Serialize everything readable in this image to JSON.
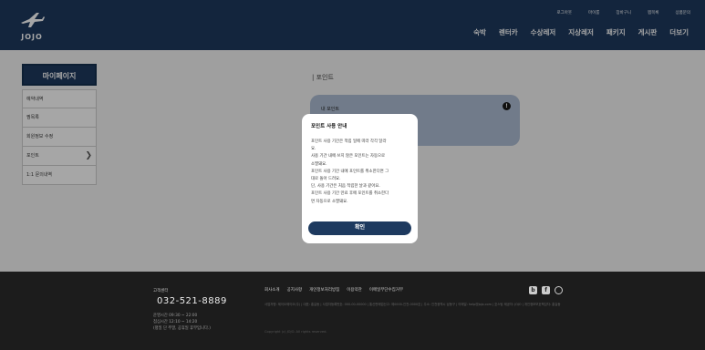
{
  "header": {
    "logo_text": "JOJO",
    "util_nav": [
      "로그아웃",
      "마이룸",
      "장바구니",
      "찜목록",
      "상품문의"
    ],
    "main_nav": [
      "숙박",
      "렌터카",
      "수상레저",
      "지상레저",
      "패키지",
      "게시판",
      "더보기"
    ]
  },
  "sidebar": {
    "title": "마이페이지",
    "items": [
      "예약내역",
      "찜목록",
      "회원정보 수정",
      "포인트",
      "1:1 문의내역"
    ]
  },
  "content": {
    "heading": "| 포인트",
    "card_label": "내 포인트"
  },
  "modal": {
    "title": "포인트 사용 안내",
    "lines": [
      "포인트 사용 기간은 적립 일에 따라 각각 달라",
      "요.",
      "사용 기간 내에 쓰지 않은 포인트는 자동으로",
      "소멸돼요.",
      "포인트 사용 기간 내에 포인트를 취소한다면 그",
      "대로 돌아 드려요.",
      "단, 사용 기간은 처음 적립한 날과 같아요.",
      "포인트 사용 기간 만료 후에 포인트를 취소한다",
      "면 자동으로 소멸돼요."
    ],
    "confirm_label": "확인"
  },
  "footer": {
    "cs_label": "고객센터",
    "phone": "032-521-8889",
    "hours": [
      "운영시간  09:30 ~ 22:00",
      "점심시간  12:10 ~ 14:20",
      "(평일 단 주말, 공휴일 휴무입니다.)"
    ],
    "links": [
      "회사소개",
      "공지사항",
      "개인정보처리방침",
      "이용약관",
      "이메일무단수집거부"
    ],
    "info": "사업자명: 제이오제이오(주) | 대표: 홍길동 | 사업자등록번호: 000-00-00000 | 통신판매업신고: 제0000-인천-0000호 | 주소: 인천광역시 남동구 | 이메일: help@jojo.com | 호스팅 제공자: JOJO | 개인정보보호책임자: 홍길동",
    "copyright": "Copyright (c) JOJO. All rights reserved.",
    "social": [
      "blog-icon",
      "facebook-icon",
      "instagram-icon"
    ]
  }
}
